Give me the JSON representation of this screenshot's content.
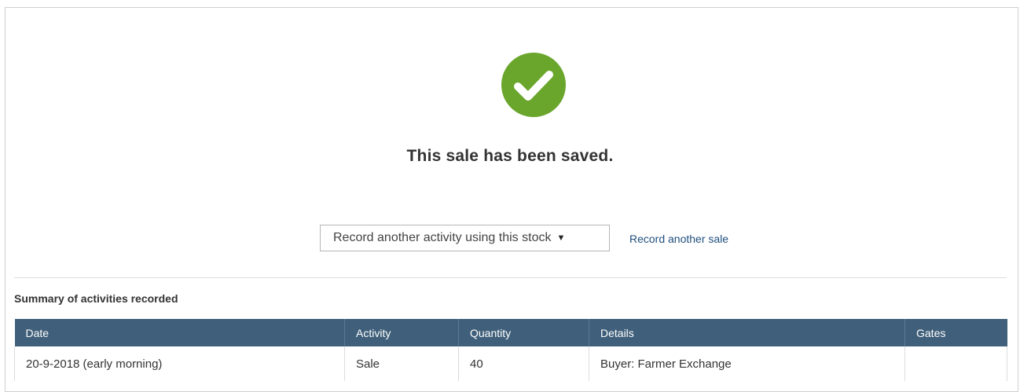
{
  "success": {
    "icon": "check-circle-icon",
    "title": "This sale has been saved.",
    "accent_color": "#6aa62c"
  },
  "actions": {
    "select_value": "Record another activity using this stock",
    "caret": "▼",
    "record_another_sale": "Record another sale"
  },
  "summary": {
    "heading": "Summary of activities recorded",
    "header_color": "#3f5f7a",
    "columns": [
      "Date",
      "Activity",
      "Quantity",
      "Details",
      "Gates"
    ],
    "rows": [
      [
        "20-9-2018 (early morning)",
        "Sale",
        "40",
        "Buyer: Farmer Exchange",
        ""
      ]
    ]
  }
}
